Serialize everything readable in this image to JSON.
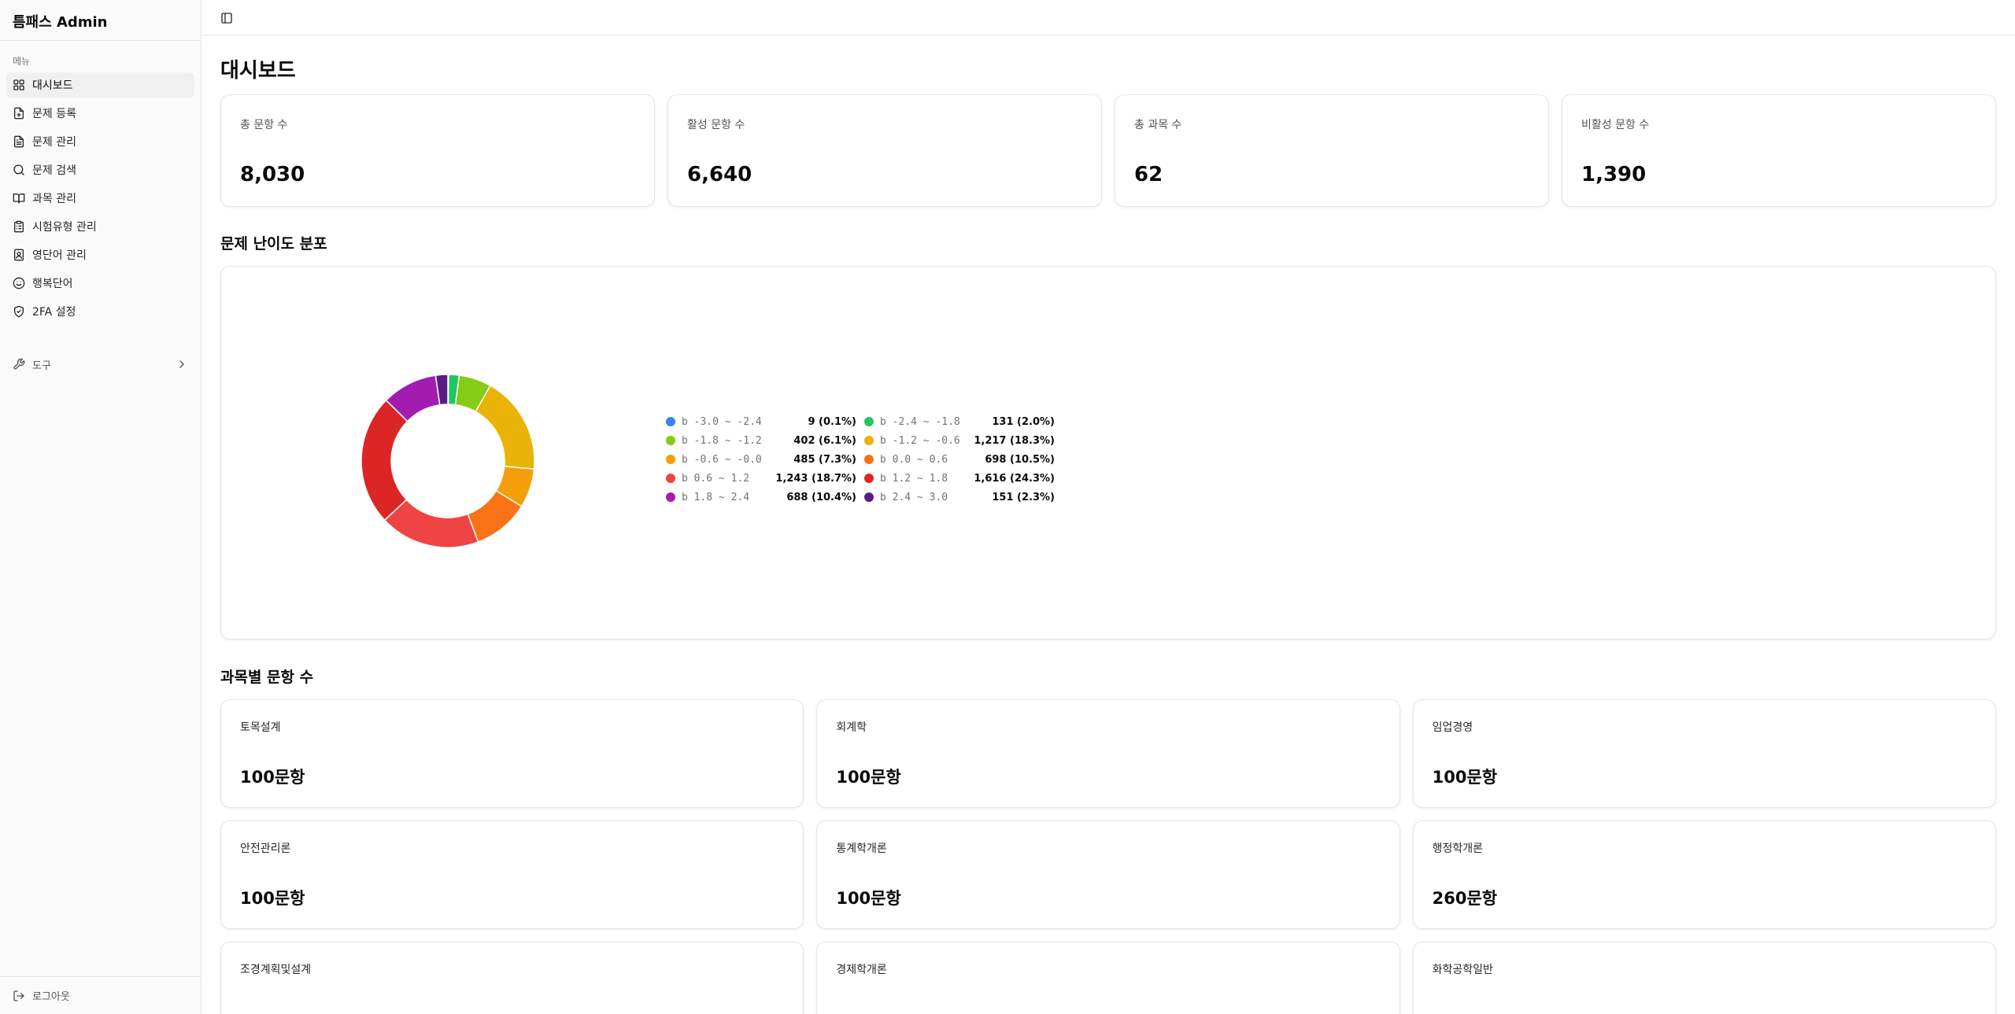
{
  "app": {
    "title": "틈패스 Admin"
  },
  "sidebar": {
    "caption": "메뉴",
    "items": [
      {
        "label": "대시보드",
        "icon": "layout-grid-icon",
        "active": true
      },
      {
        "label": "문제 등록",
        "icon": "file-plus-icon"
      },
      {
        "label": "문제 관리",
        "icon": "file-text-icon"
      },
      {
        "label": "문제 검색",
        "icon": "search-icon"
      },
      {
        "label": "과목 관리",
        "icon": "book-open-icon"
      },
      {
        "label": "시험유형 관리",
        "icon": "clipboard-list-icon"
      },
      {
        "label": "영단어 관리",
        "icon": "contact-book-icon"
      },
      {
        "label": "행복단어",
        "icon": "smile-icon"
      },
      {
        "label": "2FA 설정",
        "icon": "shield-check-icon"
      }
    ],
    "tools_label": "도구",
    "logout_label": "로그아웃"
  },
  "page": {
    "title": "대시보드"
  },
  "stats": [
    {
      "label": "총 문항 수",
      "value": "8,030"
    },
    {
      "label": "활성 문항 수",
      "value": "6,640"
    },
    {
      "label": "총 과목 수",
      "value": "62"
    },
    {
      "label": "비활성 문항 수",
      "value": "1,390"
    }
  ],
  "difficulty": {
    "title": "문제 난이도 분포",
    "legend": [
      {
        "range": "b -3.0 ~ -2.4",
        "value": "9 (0.1%)"
      },
      {
        "range": "b -2.4 ~ -1.8",
        "value": "131 (2.0%)"
      },
      {
        "range": "b -1.8 ~ -1.2",
        "value": "402 (6.1%)"
      },
      {
        "range": "b -1.2 ~ -0.6",
        "value": "1,217 (18.3%)"
      },
      {
        "range": "b -0.6 ~ -0.0",
        "value": "485 (7.3%)"
      },
      {
        "range": "b 0.0 ~ 0.6",
        "value": "698 (10.5%)"
      },
      {
        "range": "b 0.6 ~ 1.2",
        "value": "1,243 (18.7%)"
      },
      {
        "range": "b 1.2 ~ 1.8",
        "value": "1,616 (24.3%)"
      },
      {
        "range": "b 1.8 ~ 2.4",
        "value": "688 (10.4%)"
      },
      {
        "range": "b 2.4 ~ 3.0",
        "value": "151 (2.3%)"
      }
    ]
  },
  "chart_data": {
    "type": "pie",
    "categories": [
      "b -3.0 ~ -2.4",
      "b -2.4 ~ -1.8",
      "b -1.8 ~ -1.2",
      "b -1.2 ~ -0.6",
      "b -0.6 ~ -0.0",
      "b 0.0 ~ 0.6",
      "b 0.6 ~ 1.2",
      "b 1.2 ~ 1.8",
      "b 1.8 ~ 2.4",
      "b 2.4 ~ 3.0"
    ],
    "values": [
      9,
      131,
      402,
      1217,
      485,
      698,
      1243,
      1616,
      688,
      151
    ],
    "colors": [
      "#3b82f6",
      "#22c55e",
      "#84cc16",
      "#eab308",
      "#f59e0b",
      "#f97316",
      "#ef4444",
      "#dc2626",
      "#a21caf",
      "#581c87"
    ],
    "donut": true,
    "legend_position": "right"
  },
  "subjects": {
    "title": "과목별 문항 수",
    "items": [
      {
        "name": "토목설계",
        "count": "100문항"
      },
      {
        "name": "회계학",
        "count": "100문항"
      },
      {
        "name": "임업경영",
        "count": "100문항"
      },
      {
        "name": "안전관리론",
        "count": "100문항"
      },
      {
        "name": "통계학개론",
        "count": "100문항"
      },
      {
        "name": "행정학개론",
        "count": "260문항"
      },
      {
        "name": "조경계획및설계",
        "count": ""
      },
      {
        "name": "경제학개론",
        "count": ""
      },
      {
        "name": "화학공학일반",
        "count": ""
      }
    ]
  }
}
